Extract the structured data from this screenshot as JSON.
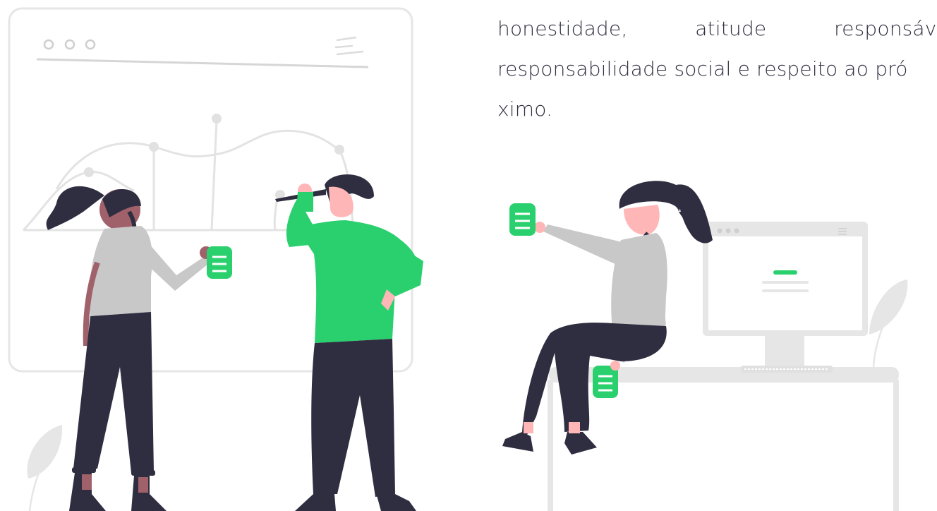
{
  "text": {
    "line1": [
      "honestidade,",
      "atitude",
      "responsáve"
    ],
    "line2": "responsabilidade social e respeito ao pró",
    "line3": "ximo."
  },
  "colors": {
    "accent": "#2bd06e",
    "dark": "#2f2e41",
    "shirt_grey": "#c8c8c8",
    "line_grey": "#e6e6e6",
    "skin_light": "#ffb6b6",
    "skin_dark": "#a0616a"
  }
}
